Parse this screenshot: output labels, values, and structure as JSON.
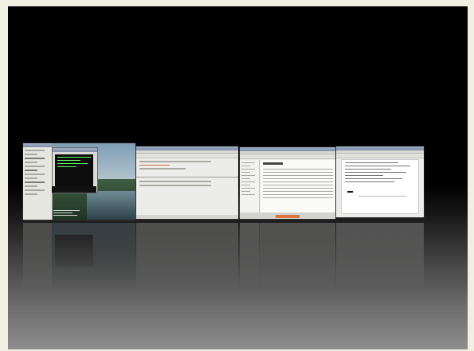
{
  "scene": {
    "description_none": "",
    "workspaces": [
      {
        "id": "workspace-1",
        "content": "desktop"
      },
      {
        "id": "workspace-2",
        "content": "mail"
      },
      {
        "id": "workspace-3",
        "content": "file-manager"
      },
      {
        "id": "workspace-4",
        "content": "document"
      }
    ]
  },
  "colors": {
    "frame": "#efefe2",
    "backdrop_top": "#000000",
    "backdrop_bottom": "#8e8e8e",
    "accent_orange": "#d7763f"
  }
}
